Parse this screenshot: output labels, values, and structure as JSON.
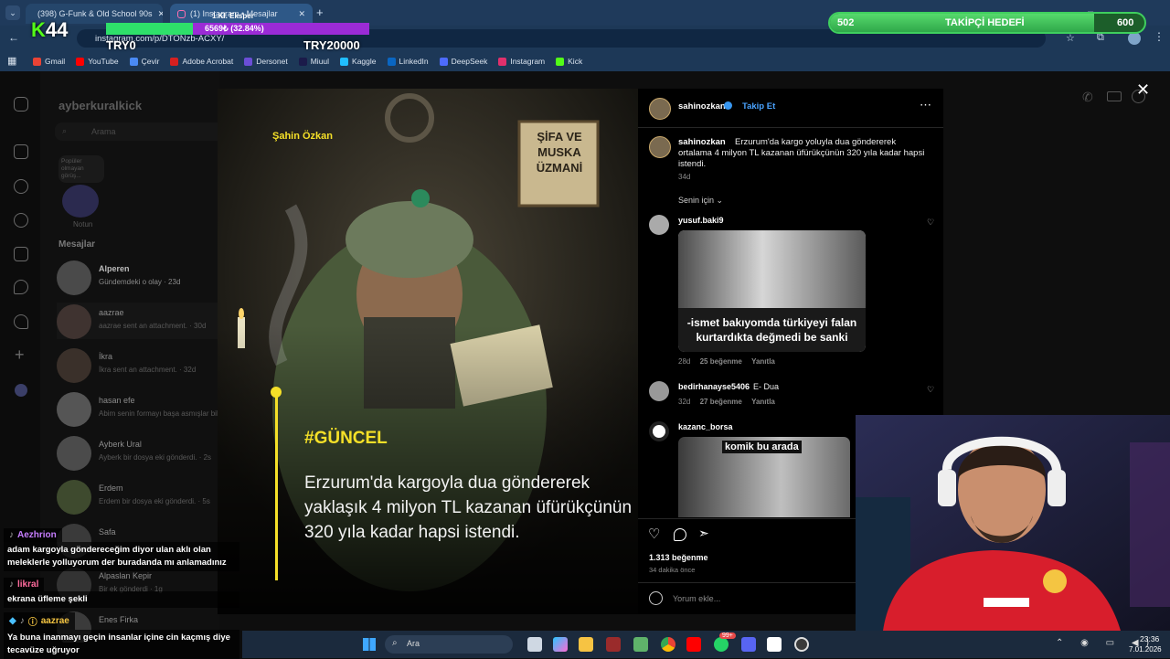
{
  "browser": {
    "tabs": [
      {
        "label": "(398) G-Funk & Old School 90s"
      },
      {
        "label": "(1) Instagram • Mesajlar"
      }
    ],
    "url": "instagram.com/p/DTONzb-ACXY/",
    "bookmarks": [
      "Gmail",
      "YouTube",
      "Çevir",
      "Adobe Acrobat",
      "Dersonet",
      "Miuul",
      "Kaggle",
      "LinkedIn",
      "DeepSeek",
      "Instagram",
      "Kick"
    ]
  },
  "stream_overlay": {
    "logo": "44",
    "badge_title": "1.Kl. Eksper",
    "progress_text": "6569₺ (32.84%)",
    "left_amount": "TRY0",
    "right_amount": "TRY20000",
    "goal": {
      "current": "502",
      "label": "TAKİPÇİ HEDEFİ",
      "target": "600",
      "fraction": 0.84
    }
  },
  "instagram": {
    "username": "ayberkuralkick",
    "search_placeholder": "Arama",
    "note_text": "Popüler olmayan görüş...",
    "note_label": "Notun",
    "messages_header": "Mesajlar",
    "conversations": [
      {
        "name": "Alperen",
        "preview": "Gündemdeki o olay · 23d"
      },
      {
        "name": "aazrae",
        "preview": "aazrae sent an attachment. · 30d"
      },
      {
        "name": "İkra",
        "preview": "İkra sent an attachment. · 32d"
      },
      {
        "name": "hasan efe",
        "preview": "Abim senin formayı başa asmışlar bil"
      },
      {
        "name": "Ayberk Ural",
        "preview": "Ayberk bir dosya eki gönderdi. · 2s"
      },
      {
        "name": "Erdem",
        "preview": "Erdem bir dosya eki gönderdi. · 5s"
      },
      {
        "name": "Safa",
        "preview": ""
      },
      {
        "name": "Alpaslan Kepir",
        "preview": "Bir ek gönderdi · 1g"
      },
      {
        "name": "Enes Firka",
        "preview": ""
      }
    ],
    "post": {
      "watermark_name": "Şahin Özkan",
      "sign_text": "ŞİFA VE MUSKA ÜZMANİ",
      "tag": "#GÜNCEL",
      "headline": "Erzurum'da kargoyla dua göndererek yaklaşık 4 milyon TL kazanan üfürükçünün 320 yıla kadar hapsi istendi.",
      "author": "sahinozkan",
      "follow_label": "Takip Et",
      "caption": "Erzurum'da kargo yoluyla dua göndererek ortalama 4 milyon TL kazanan üfürükçünün 320 yıla kadar hapsi istendi.",
      "caption_age": "34d",
      "sort_label": "Senin için",
      "comments": [
        {
          "user": "yusuf.baki9",
          "meme_text": "-ismet bakıyomda türkiyeyi falan kurtardıkta değmedi be sanki",
          "age": "28d",
          "likes": "25 beğenme",
          "reply": "Yanıtla"
        },
        {
          "user": "bedirhanayse5406",
          "text": "E- Dua",
          "age": "32d",
          "likes": "27 beğenme",
          "reply": "Yanıtla"
        },
        {
          "user": "kazanc_borsa",
          "meme_text": "komik bu arada"
        }
      ],
      "likes_total": "1.313 beğenme",
      "time_ago": "34 dakika önce",
      "add_comment_placeholder": "Yorum ekle..."
    }
  },
  "chat": [
    {
      "user": "Aezhrion",
      "color": "#c77dff",
      "text": "adam kargoyla göndereceğim diyor ulan aklı olan meleklerle yolluyorum der buradanda mı anlamadınız"
    },
    {
      "user": "likral",
      "color": "#ff6b9d",
      "text": "ekrana üfleme şekli"
    },
    {
      "user": "aazrae",
      "color": "#f5c542",
      "text": "Ya buna inanmayı geçin insanlar içine cin kaçmış diye tecavüze uğruyor"
    }
  ],
  "taskbar": {
    "search_label": "Ara",
    "time": "23:36",
    "date": "7.01.2026",
    "badge": "99+"
  }
}
